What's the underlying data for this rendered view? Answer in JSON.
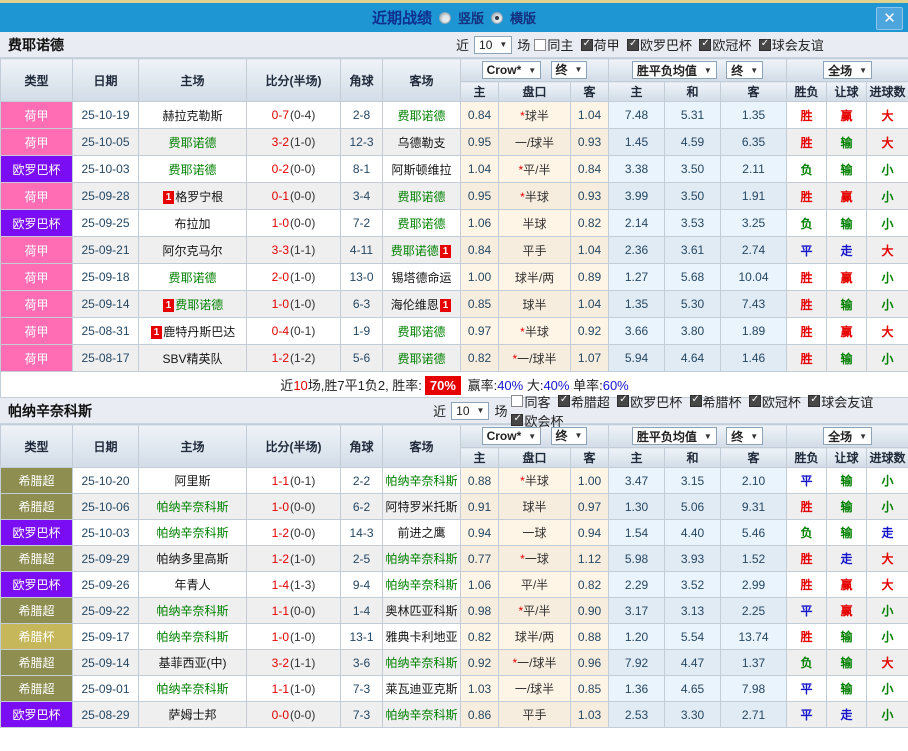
{
  "titlebar": {
    "title": "近期战绩",
    "radio_vertical": "竖版",
    "radio_horizontal": "横版",
    "selected_layout": "横版",
    "close": "✕"
  },
  "colors": {
    "topbar_blue": "#1E96D4",
    "win_red": "#E60000",
    "lose_green": "#008000",
    "draw_blue": "#1414CC",
    "focal_team_green": "#008000"
  },
  "league_colors": {
    "荷甲": "#FF6EB4",
    "欧罗巴杯": "#7B0DF5",
    "希腊超": "#8E8E51",
    "希腊杯": "#C6B75A"
  },
  "first_leg_flag": "1",
  "table_columns": {
    "near_label": "近",
    "near_value": "10",
    "games_label": "场",
    "type": "类型",
    "date": "日期",
    "home": "主场",
    "score": "比分(半场)",
    "corner": "角球",
    "away": "客场",
    "dropdown_crow": "Crow*",
    "dropdown_final1": "终",
    "dropdown_mean": "胜平负均值",
    "dropdown_final2": "终",
    "dropdown_fullmatch": "全场",
    "odds_sub": [
      "主",
      "盘口",
      "客"
    ],
    "mean_sub": [
      "主",
      "和",
      "客"
    ],
    "result_sub": [
      "胜负",
      "让球",
      "进球数"
    ]
  },
  "sections": [
    {
      "team": "费耶诺德",
      "filters": [
        {
          "label": "同主",
          "checked": false
        },
        {
          "label": "荷甲",
          "checked": true
        },
        {
          "label": "欧罗巴杯",
          "checked": true
        },
        {
          "label": "欧冠杯",
          "checked": true
        },
        {
          "label": "球会友谊",
          "checked": true
        }
      ],
      "rows": [
        {
          "league": "荷甲",
          "date": "25-10-19",
          "home": {
            "name": "赫拉克勒斯",
            "focal": false,
            "badge": null
          },
          "ft": "0-7",
          "ht": "(0-4)",
          "corner": "2-8",
          "away": {
            "name": "费耶诺德",
            "focal": true,
            "badge": null
          },
          "o1": "0.84",
          "star": true,
          "hcp": "球半",
          "o2": "1.04",
          "m": [
            "7.48",
            "5.31",
            "1.35"
          ],
          "res": [
            [
              "胜",
              "r"
            ],
            [
              "赢",
              "r"
            ],
            [
              "大",
              "r"
            ]
          ]
        },
        {
          "league": "荷甲",
          "date": "25-10-05",
          "home": {
            "name": "费耶诺德",
            "focal": true,
            "badge": null
          },
          "ft": "3-2",
          "ht": "(1-0)",
          "corner": "12-3",
          "away": {
            "name": "乌德勒支",
            "focal": false,
            "badge": null
          },
          "o1": "0.95",
          "star": false,
          "hcp": "一/球半",
          "o2": "0.93",
          "m": [
            "1.45",
            "4.59",
            "6.35"
          ],
          "res": [
            [
              "胜",
              "r"
            ],
            [
              "输",
              "g"
            ],
            [
              "大",
              "r"
            ]
          ]
        },
        {
          "league": "欧罗巴杯",
          "date": "25-10-03",
          "home": {
            "name": "费耶诺德",
            "focal": true,
            "badge": null
          },
          "ft": "0-2",
          "ht": "(0-0)",
          "corner": "8-1",
          "away": {
            "name": "阿斯顿维拉",
            "focal": false,
            "badge": null
          },
          "o1": "1.04",
          "star": true,
          "hcp": "平/半",
          "o2": "0.84",
          "m": [
            "3.38",
            "3.50",
            "2.11"
          ],
          "res": [
            [
              "负",
              "g"
            ],
            [
              "输",
              "g"
            ],
            [
              "小",
              "g"
            ]
          ]
        },
        {
          "league": "荷甲",
          "date": "25-09-28",
          "home": {
            "name": "格罗宁根",
            "focal": false,
            "badge": "before"
          },
          "ft": "0-1",
          "ht": "(0-0)",
          "corner": "3-4",
          "away": {
            "name": "费耶诺德",
            "focal": true,
            "badge": null
          },
          "o1": "0.95",
          "star": true,
          "hcp": "半球",
          "o2": "0.93",
          "m": [
            "3.99",
            "3.50",
            "1.91"
          ],
          "res": [
            [
              "胜",
              "r"
            ],
            [
              "赢",
              "r"
            ],
            [
              "小",
              "g"
            ]
          ]
        },
        {
          "league": "欧罗巴杯",
          "date": "25-09-25",
          "home": {
            "name": "布拉加",
            "focal": false,
            "badge": null
          },
          "ft": "1-0",
          "ht": "(0-0)",
          "corner": "7-2",
          "away": {
            "name": "费耶诺德",
            "focal": true,
            "badge": null
          },
          "o1": "1.06",
          "star": false,
          "hcp": "半球",
          "o2": "0.82",
          "m": [
            "2.14",
            "3.53",
            "3.25"
          ],
          "res": [
            [
              "负",
              "g"
            ],
            [
              "输",
              "g"
            ],
            [
              "小",
              "g"
            ]
          ]
        },
        {
          "league": "荷甲",
          "date": "25-09-21",
          "home": {
            "name": "阿尔克马尔",
            "focal": false,
            "badge": null
          },
          "ft": "3-3",
          "ht": "(1-1)",
          "corner": "4-11",
          "away": {
            "name": "费耶诺德",
            "focal": true,
            "badge": "after"
          },
          "o1": "0.84",
          "star": false,
          "hcp": "平手",
          "o2": "1.04",
          "m": [
            "2.36",
            "3.61",
            "2.74"
          ],
          "res": [
            [
              "平",
              "b"
            ],
            [
              "走",
              "b"
            ],
            [
              "大",
              "r"
            ]
          ]
        },
        {
          "league": "荷甲",
          "date": "25-09-18",
          "home": {
            "name": "费耶诺德",
            "focal": true,
            "badge": null
          },
          "ft": "2-0",
          "ht": "(1-0)",
          "corner": "13-0",
          "away": {
            "name": "锡塔德命运",
            "focal": false,
            "badge": null
          },
          "o1": "1.00",
          "star": false,
          "hcp": "球半/两",
          "o2": "0.89",
          "m": [
            "1.27",
            "5.68",
            "10.04"
          ],
          "res": [
            [
              "胜",
              "r"
            ],
            [
              "赢",
              "r"
            ],
            [
              "小",
              "g"
            ]
          ]
        },
        {
          "league": "荷甲",
          "date": "25-09-14",
          "home": {
            "name": "费耶诺德",
            "focal": true,
            "badge": "before"
          },
          "ft": "1-0",
          "ht": "(1-0)",
          "corner": "6-3",
          "away": {
            "name": "海伦维恩",
            "focal": false,
            "badge": "after"
          },
          "o1": "0.85",
          "star": false,
          "hcp": "球半",
          "o2": "1.04",
          "m": [
            "1.35",
            "5.30",
            "7.43"
          ],
          "res": [
            [
              "胜",
              "r"
            ],
            [
              "输",
              "g"
            ],
            [
              "小",
              "g"
            ]
          ]
        },
        {
          "league": "荷甲",
          "date": "25-08-31",
          "home": {
            "name": "鹿特丹斯巴达",
            "focal": false,
            "badge": "before"
          },
          "ft": "0-4",
          "ht": "(0-1)",
          "corner": "1-9",
          "away": {
            "name": "费耶诺德",
            "focal": true,
            "badge": null
          },
          "o1": "0.97",
          "star": true,
          "hcp": "半球",
          "o2": "0.92",
          "m": [
            "3.66",
            "3.80",
            "1.89"
          ],
          "res": [
            [
              "胜",
              "r"
            ],
            [
              "赢",
              "r"
            ],
            [
              "大",
              "r"
            ]
          ]
        },
        {
          "league": "荷甲",
          "date": "25-08-17",
          "home": {
            "name": "SBV精英队",
            "focal": false,
            "badge": null
          },
          "ft": "1-2",
          "ht": "(1-2)",
          "corner": "5-6",
          "away": {
            "name": "费耶诺德",
            "focal": true,
            "badge": null
          },
          "o1": "0.82",
          "star": true,
          "hcp": "一/球半",
          "o2": "1.07",
          "m": [
            "5.94",
            "4.64",
            "1.46"
          ],
          "res": [
            [
              "胜",
              "r"
            ],
            [
              "输",
              "g"
            ],
            [
              "小",
              "g"
            ]
          ]
        }
      ],
      "summary": [
        {
          "t": "近",
          "s": "k"
        },
        {
          "t": "10",
          "s": "r"
        },
        {
          "t": "场,胜7平1负2, 胜率:",
          "s": "k"
        },
        {
          "t": "70%",
          "s": "hl"
        },
        {
          "t": " 赢率:",
          "s": "k"
        },
        {
          "t": "40%",
          "s": "b"
        },
        {
          "t": " 大:",
          "s": "k"
        },
        {
          "t": "40%",
          "s": "b"
        },
        {
          "t": " 单率:",
          "s": "k"
        },
        {
          "t": "60%",
          "s": "b"
        }
      ]
    },
    {
      "team": "帕纳辛奈科斯",
      "filters": [
        {
          "label": "同客",
          "checked": false
        },
        {
          "label": "希腊超",
          "checked": true
        },
        {
          "label": "欧罗巴杯",
          "checked": true
        },
        {
          "label": "希腊杯",
          "checked": true
        },
        {
          "label": "欧冠杯",
          "checked": true
        },
        {
          "label": "球会友谊",
          "checked": true
        },
        {
          "label": "欧会杯",
          "checked": true
        }
      ],
      "rows": [
        {
          "league": "希腊超",
          "date": "25-10-20",
          "home": {
            "name": "阿里斯",
            "focal": false,
            "badge": null
          },
          "ft": "1-1",
          "ht": "(0-1)",
          "corner": "2-2",
          "away": {
            "name": "帕纳辛奈科斯",
            "focal": true,
            "badge": null
          },
          "o1": "0.88",
          "star": true,
          "hcp": "半球",
          "o2": "1.00",
          "m": [
            "3.47",
            "3.15",
            "2.10"
          ],
          "res": [
            [
              "平",
              "b"
            ],
            [
              "输",
              "g"
            ],
            [
              "小",
              "g"
            ]
          ]
        },
        {
          "league": "希腊超",
          "date": "25-10-06",
          "home": {
            "name": "帕纳辛奈科斯",
            "focal": true,
            "badge": null
          },
          "ft": "1-0",
          "ht": "(0-0)",
          "corner": "6-2",
          "away": {
            "name": "阿特罗米托斯",
            "focal": false,
            "badge": null
          },
          "o1": "0.91",
          "star": false,
          "hcp": "球半",
          "o2": "0.97",
          "m": [
            "1.30",
            "5.06",
            "9.31"
          ],
          "res": [
            [
              "胜",
              "r"
            ],
            [
              "输",
              "g"
            ],
            [
              "小",
              "g"
            ]
          ]
        },
        {
          "league": "欧罗巴杯",
          "date": "25-10-03",
          "home": {
            "name": "帕纳辛奈科斯",
            "focal": true,
            "badge": null
          },
          "ft": "1-2",
          "ht": "(0-0)",
          "corner": "14-3",
          "away": {
            "name": "前进之鹰",
            "focal": false,
            "badge": null
          },
          "o1": "0.94",
          "star": false,
          "hcp": "一球",
          "o2": "0.94",
          "m": [
            "1.54",
            "4.40",
            "5.46"
          ],
          "res": [
            [
              "负",
              "g"
            ],
            [
              "输",
              "g"
            ],
            [
              "走",
              "b"
            ]
          ]
        },
        {
          "league": "希腊超",
          "date": "25-09-29",
          "home": {
            "name": "帕纳多里高斯",
            "focal": false,
            "badge": null
          },
          "ft": "1-2",
          "ht": "(1-0)",
          "corner": "2-5",
          "away": {
            "name": "帕纳辛奈科斯",
            "focal": true,
            "badge": null
          },
          "o1": "0.77",
          "star": true,
          "hcp": "一球",
          "o2": "1.12",
          "m": [
            "5.98",
            "3.93",
            "1.52"
          ],
          "res": [
            [
              "胜",
              "r"
            ],
            [
              "走",
              "b"
            ],
            [
              "大",
              "r"
            ]
          ]
        },
        {
          "league": "欧罗巴杯",
          "date": "25-09-26",
          "home": {
            "name": "年青人",
            "focal": false,
            "badge": null
          },
          "ft": "1-4",
          "ht": "(1-3)",
          "corner": "9-4",
          "away": {
            "name": "帕纳辛奈科斯",
            "focal": true,
            "badge": null
          },
          "o1": "1.06",
          "star": false,
          "hcp": "平/半",
          "o2": "0.82",
          "m": [
            "2.29",
            "3.52",
            "2.99"
          ],
          "res": [
            [
              "胜",
              "r"
            ],
            [
              "赢",
              "r"
            ],
            [
              "大",
              "r"
            ]
          ]
        },
        {
          "league": "希腊超",
          "date": "25-09-22",
          "home": {
            "name": "帕纳辛奈科斯",
            "focal": true,
            "badge": null
          },
          "ft": "1-1",
          "ht": "(0-0)",
          "corner": "1-4",
          "away": {
            "name": "奥林匹亚科斯",
            "focal": false,
            "badge": null
          },
          "o1": "0.98",
          "star": true,
          "hcp": "平/半",
          "o2": "0.90",
          "m": [
            "3.17",
            "3.13",
            "2.25"
          ],
          "res": [
            [
              "平",
              "b"
            ],
            [
              "赢",
              "r"
            ],
            [
              "小",
              "g"
            ]
          ]
        },
        {
          "league": "希腊杯",
          "date": "25-09-17",
          "home": {
            "name": "帕纳辛奈科斯",
            "focal": true,
            "badge": null
          },
          "ft": "1-0",
          "ht": "(1-0)",
          "corner": "13-1",
          "away": {
            "name": "雅典卡利地亚",
            "focal": false,
            "badge": null
          },
          "o1": "0.82",
          "star": false,
          "hcp": "球半/两",
          "o2": "0.88",
          "m": [
            "1.20",
            "5.54",
            "13.74"
          ],
          "res": [
            [
              "胜",
              "r"
            ],
            [
              "输",
              "g"
            ],
            [
              "小",
              "g"
            ]
          ]
        },
        {
          "league": "希腊超",
          "date": "25-09-14",
          "home": {
            "name": "基菲西亚(中)",
            "focal": false,
            "badge": null
          },
          "ft": "3-2",
          "ht": "(1-1)",
          "corner": "3-6",
          "away": {
            "name": "帕纳辛奈科斯",
            "focal": true,
            "badge": null
          },
          "o1": "0.92",
          "star": true,
          "hcp": "一/球半",
          "o2": "0.96",
          "m": [
            "7.92",
            "4.47",
            "1.37"
          ],
          "res": [
            [
              "负",
              "g"
            ],
            [
              "输",
              "g"
            ],
            [
              "大",
              "r"
            ]
          ]
        },
        {
          "league": "希腊超",
          "date": "25-09-01",
          "home": {
            "name": "帕纳辛奈科斯",
            "focal": true,
            "badge": null
          },
          "ft": "1-1",
          "ht": "(1-0)",
          "corner": "7-3",
          "away": {
            "name": "莱瓦迪亚克斯",
            "focal": false,
            "badge": null
          },
          "o1": "1.03",
          "star": false,
          "hcp": "一/球半",
          "o2": "0.85",
          "m": [
            "1.36",
            "4.65",
            "7.98"
          ],
          "res": [
            [
              "平",
              "b"
            ],
            [
              "输",
              "g"
            ],
            [
              "小",
              "g"
            ]
          ]
        },
        {
          "league": "欧罗巴杯",
          "date": "25-08-29",
          "home": {
            "name": "萨姆士邦",
            "focal": false,
            "badge": null
          },
          "ft": "0-0",
          "ht": "(0-0)",
          "corner": "7-3",
          "away": {
            "name": "帕纳辛奈科斯",
            "focal": true,
            "badge": null
          },
          "o1": "0.86",
          "star": false,
          "hcp": "平手",
          "o2": "1.03",
          "m": [
            "2.53",
            "3.30",
            "2.71"
          ],
          "res": [
            [
              "平",
              "b"
            ],
            [
              "走",
              "b"
            ],
            [
              "小",
              "g"
            ]
          ]
        }
      ],
      "summary": null
    }
  ]
}
